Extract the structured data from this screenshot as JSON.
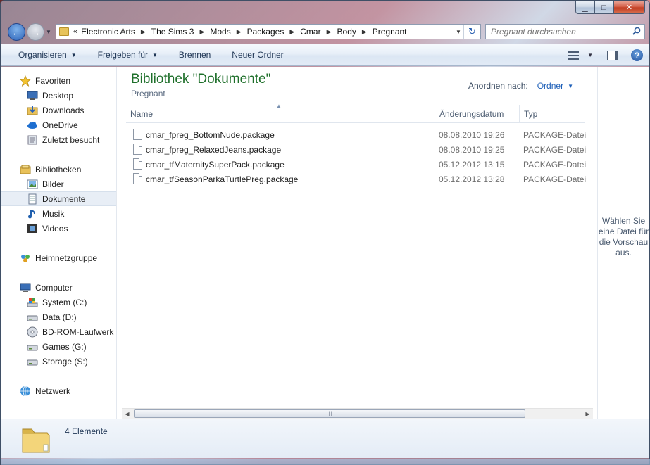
{
  "window": {
    "caption_buttons": {
      "minimize": "▁",
      "maximize": "□",
      "close": "✕"
    }
  },
  "address": {
    "overflow": "«",
    "breadcrumbs": [
      "Electronic Arts",
      "The Sims 3",
      "Mods",
      "Packages",
      "Cmar",
      "Body",
      "Pregnant"
    ],
    "search_placeholder": "Pregnant durchsuchen"
  },
  "toolbar": {
    "organize": "Organisieren",
    "share": "Freigeben für",
    "burn": "Brennen",
    "new_folder": "Neuer Ordner"
  },
  "sidebar": {
    "items": [
      {
        "label": "Favoriten",
        "icon": "star-icon",
        "indent": false
      },
      {
        "label": "Desktop",
        "icon": "desktop-icon",
        "indent": true
      },
      {
        "label": "Downloads",
        "icon": "downloads-icon",
        "indent": true
      },
      {
        "label": "OneDrive",
        "icon": "cloud-icon",
        "indent": true
      },
      {
        "label": "Zuletzt besucht",
        "icon": "recent-icon",
        "indent": true
      },
      {
        "label": "Bibliotheken",
        "icon": "library-icon",
        "indent": false
      },
      {
        "label": "Bilder",
        "icon": "pictures-icon",
        "indent": true
      },
      {
        "label": "Dokumente",
        "icon": "documents-icon",
        "indent": true,
        "selected": true
      },
      {
        "label": "Musik",
        "icon": "music-icon",
        "indent": true
      },
      {
        "label": "Videos",
        "icon": "videos-icon",
        "indent": true
      },
      {
        "label": "Heimnetzgruppe",
        "icon": "homegroup-icon",
        "indent": false
      },
      {
        "label": "Computer",
        "icon": "computer-icon",
        "indent": false
      },
      {
        "label": "System (C:)",
        "icon": "system-drive-icon",
        "indent": true
      },
      {
        "label": "Data (D:)",
        "icon": "drive-icon",
        "indent": true
      },
      {
        "label": "BD-ROM-Laufwerk (",
        "icon": "disc-drive-icon",
        "indent": true
      },
      {
        "label": "Games (G:)",
        "icon": "drive-icon",
        "indent": true
      },
      {
        "label": "Storage (S:)",
        "icon": "drive-icon",
        "indent": true
      },
      {
        "label": "Netzwerk",
        "icon": "network-icon",
        "indent": false
      }
    ]
  },
  "main": {
    "title": "Bibliothek \"Dokumente\"",
    "subtitle": "Pregnant",
    "arrange_label": "Anordnen nach:",
    "arrange_value": "Ordner",
    "columns": [
      "Name",
      "Änderungsdatum",
      "Typ"
    ],
    "files": [
      {
        "name": "cmar_fpreg_BottomNude.package",
        "date": "08.08.2010 19:26",
        "type": "PACKAGE-Datei"
      },
      {
        "name": "cmar_fpreg_RelaxedJeans.package",
        "date": "08.08.2010 19:25",
        "type": "PACKAGE-Datei"
      },
      {
        "name": "cmar_tfMaternitySuperPack.package",
        "date": "05.12.2012 13:15",
        "type": "PACKAGE-Datei"
      },
      {
        "name": "cmar_tfSeasonParkaTurtlePreg.package",
        "date": "05.12.2012 13:28",
        "type": "PACKAGE-Datei"
      }
    ]
  },
  "preview": {
    "text": "Wählen Sie eine Datei für die Vorschau aus."
  },
  "details": {
    "count": "4 Elemente"
  }
}
